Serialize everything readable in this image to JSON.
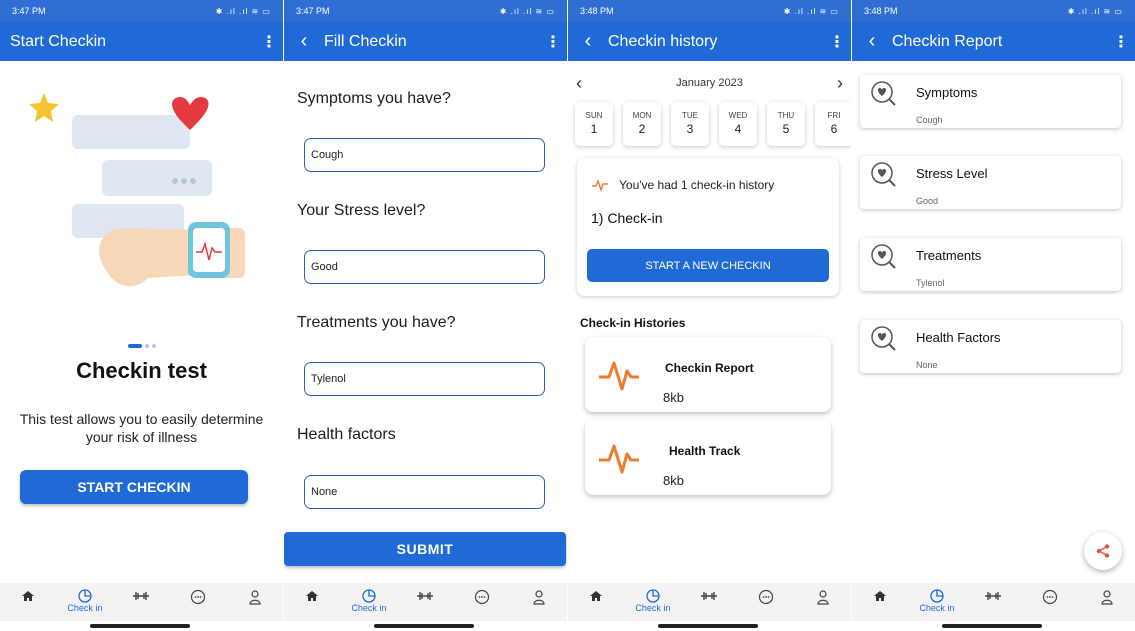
{
  "status": {
    "screens": [
      {
        "time": "3:47 PM"
      },
      {
        "time": "3:47 PM"
      },
      {
        "time": "3:48 PM"
      },
      {
        "time": "3:48 PM"
      }
    ]
  },
  "colors": {
    "primary": "#1f6ad6",
    "accent_orange": "#f07c2c",
    "statusbar": "#2f6fd3"
  },
  "screen1": {
    "title": "Start Checkin",
    "heading": "Checkin test",
    "description": "This test allows you to easily determine your risk of illness",
    "start_button": "START CHECKIN"
  },
  "screen2": {
    "title": "Fill Checkin",
    "fields": [
      {
        "label": "Symptoms you have?",
        "value": "Cough"
      },
      {
        "label": "Your Stress level?",
        "value": "Good"
      },
      {
        "label": "Treatments you have?",
        "value": "Tylenol"
      },
      {
        "label": "Health factors",
        "value": "None"
      }
    ],
    "submit_button": "SUBMIT"
  },
  "screen3": {
    "title": "Checkin history",
    "month": "January 2023",
    "days": [
      {
        "name": "SUN",
        "num": "1"
      },
      {
        "name": "MON",
        "num": "2"
      },
      {
        "name": "TUE",
        "num": "3"
      },
      {
        "name": "WED",
        "num": "4"
      },
      {
        "name": "THU",
        "num": "5"
      },
      {
        "name": "FRI",
        "num": "6"
      }
    ],
    "summary": "You've had 1 check-in history",
    "item": "1) Check-in",
    "new_button": "START A NEW CHECKIN",
    "section_title": "Check-in Histories",
    "reports": [
      {
        "title": "Checkin Report",
        "size": "8kb"
      },
      {
        "title": "Health Track",
        "size": "8kb"
      }
    ]
  },
  "screen4": {
    "title": "Checkin Report",
    "items": [
      {
        "title": "Symptoms",
        "value": "Cough"
      },
      {
        "title": "Stress Level",
        "value": "Good"
      },
      {
        "title": "Treatments",
        "value": "Tylenol"
      },
      {
        "title": "Health Factors",
        "value": "None"
      }
    ]
  },
  "nav": {
    "checkin_label": "Check in",
    "icons": [
      "home-icon",
      "checkin-icon",
      "fitness-icon",
      "chat-icon",
      "profile-icon"
    ]
  }
}
